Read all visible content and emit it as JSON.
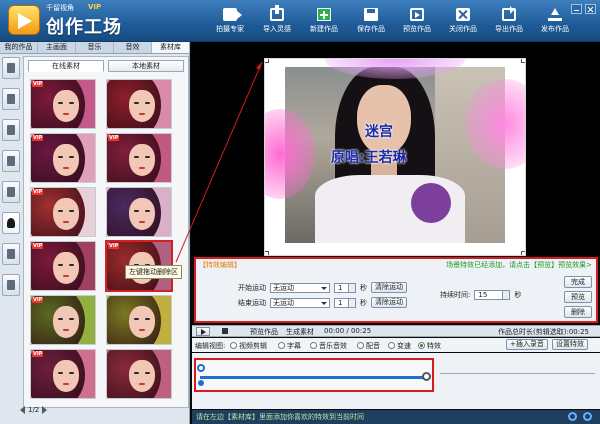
{
  "header": {
    "brand_small": "千留视角",
    "brand_vip": "VIP",
    "brand_title": "创作工场",
    "window_tag": "",
    "toolbar": [
      {
        "label": "拍摄专家",
        "icon": "camera-icon"
      },
      {
        "label": "导入灵感",
        "icon": "import-icon"
      },
      {
        "label": "新建作品",
        "icon": "new-icon"
      },
      {
        "label": "保存作品",
        "icon": "save-icon"
      },
      {
        "label": "预览作品",
        "icon": "preview-icon"
      },
      {
        "label": "关闭作品",
        "icon": "close-icon"
      },
      {
        "label": "导出作品",
        "icon": "export-icon"
      },
      {
        "label": "发布作品",
        "icon": "publish-icon"
      }
    ]
  },
  "sidebar": {
    "tabs": [
      "我的作品",
      "主画面",
      "音乐",
      "音效",
      "素材库"
    ],
    "active_tab": 4,
    "subtabs": [
      "在线素材",
      "本地素材"
    ],
    "active_subtab": 0,
    "vip_badge": "VIP",
    "tooltip": "左键拖动删除区",
    "pager": "1/2"
  },
  "preview": {
    "lyric_line1": "迷宫",
    "lyric_line2": "原唱:王若琳"
  },
  "effect_editor": {
    "title": "【特效编辑】",
    "hint": "场景特效已经添加，请点击【预览】预览效果>",
    "start_label": "开始运动",
    "end_label": "结束运动",
    "start_motion": "无运动",
    "end_motion": "无运动",
    "start_seconds": "1",
    "end_seconds": "1",
    "unit_seconds": "秒",
    "clear_start": "清除运动",
    "clear_end": "清除运动",
    "duration_label": "持续时间:",
    "duration_value": "15",
    "done_button": "完成",
    "preview_button": "预览",
    "delete_button": "删除"
  },
  "timeline": {
    "preview_label": "预览作品",
    "generate_label": "生成素材",
    "time_readout": "00:00 / 00:25",
    "total_label": "作品总时长(剪辑选取):00:25",
    "view_label": "编辑视图:",
    "views": [
      "视频剪辑",
      "字幕",
      "音乐音效",
      "配音",
      "变速",
      "特效"
    ],
    "active_view": 5,
    "insert_button": "+插入录音",
    "settings_button": "设置特效"
  },
  "status": {
    "message": "请在左边【素材库】里面添加你喜欢的特效到当前时间"
  },
  "colors": {
    "header_blue": "#1f5b98",
    "highlight_red": "#d41c1c",
    "track_blue": "#1f6fd0",
    "title_orange": "#e57a00",
    "hint_green": "#1a9a22"
  }
}
